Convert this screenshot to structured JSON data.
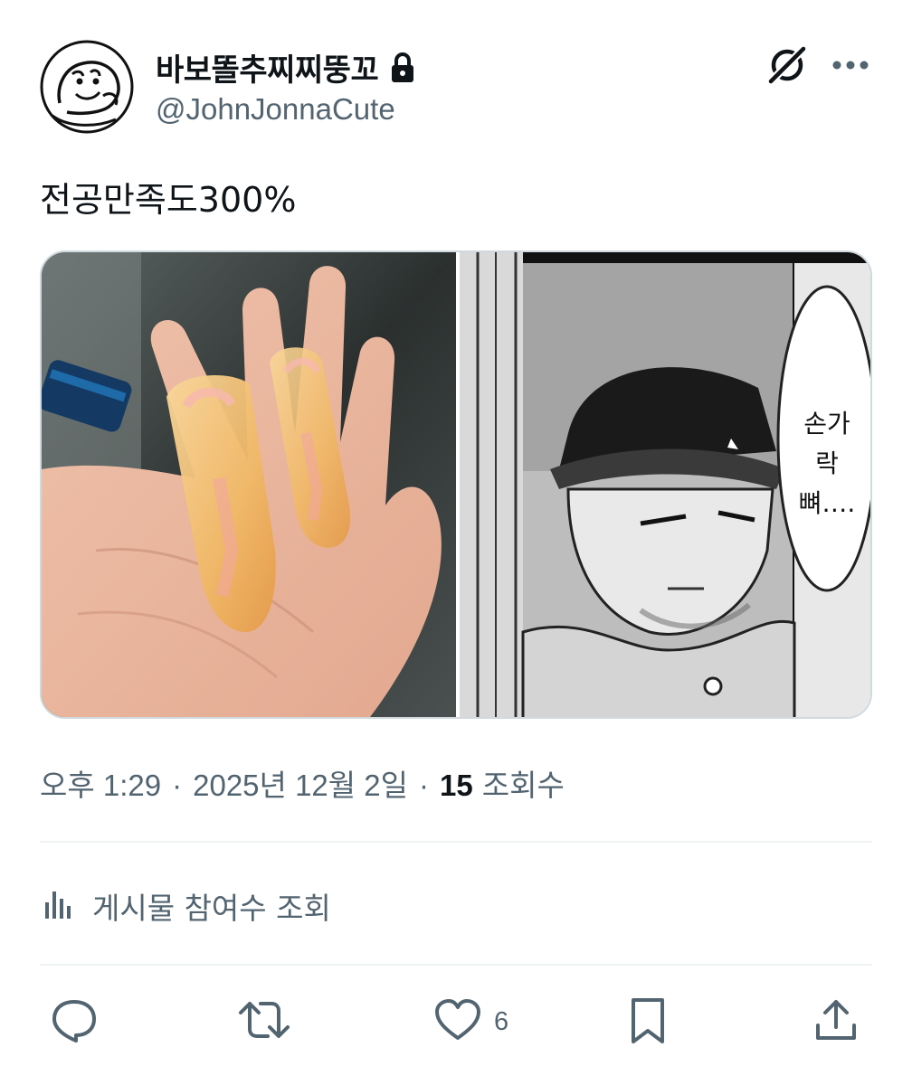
{
  "post": {
    "author": {
      "display_name": "바보똘추찌찌뚱꼬",
      "handle": "@JohnJonnaCute",
      "locked": true
    },
    "text": "전공만족도300%",
    "media": {
      "panel_speech": "손가락\n뼈…."
    },
    "meta": {
      "time": "오후 1:29",
      "date": "2025년 12월 2일",
      "views_count": "15",
      "views_label": "조회수",
      "separator": "·"
    },
    "engagements_label": "게시물 참여수 조회",
    "actions": {
      "like_count": "6"
    }
  },
  "icons": {
    "grok": "grok-icon",
    "more": "more-dots-icon",
    "lock": "lock-icon",
    "analytics": "bar-chart-icon",
    "reply": "reply-bubble-icon",
    "retweet": "retweet-icon",
    "like": "heart-icon",
    "bookmark": "bookmark-icon",
    "share": "share-upload-icon"
  },
  "colors": {
    "primary_text": "#0f1419",
    "secondary_text": "#536471",
    "border": "#cfd9de",
    "divider": "#eff3f4"
  }
}
